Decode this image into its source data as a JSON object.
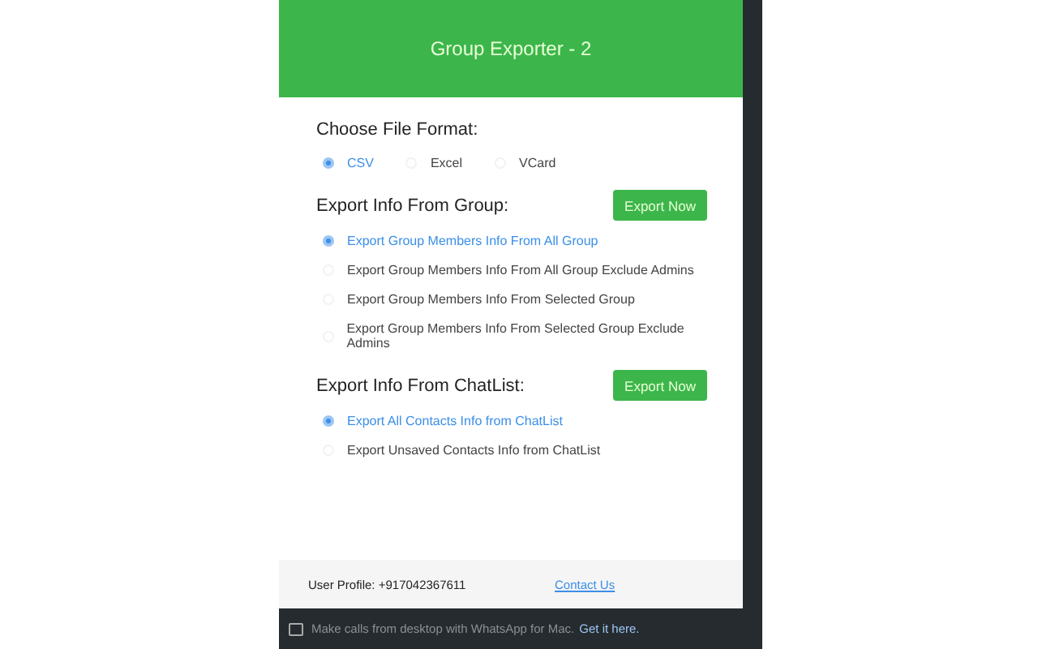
{
  "header": {
    "title": "Group Exporter - 2"
  },
  "file_format": {
    "heading": "Choose File Format:",
    "options": [
      {
        "label": "CSV",
        "selected": true
      },
      {
        "label": "Excel",
        "selected": false
      },
      {
        "label": "VCard",
        "selected": false
      }
    ]
  },
  "group_section": {
    "heading": "Export Info From Group:",
    "button": "Export Now",
    "options": [
      {
        "label": "Export Group Members Info From All Group",
        "selected": true
      },
      {
        "label": "Export Group Members Info From All Group Exclude Admins",
        "selected": false
      },
      {
        "label": "Export Group Members Info From Selected Group",
        "selected": false
      },
      {
        "label": "Export Group Members Info From Selected Group Exclude Admins",
        "selected": false
      }
    ]
  },
  "chatlist_section": {
    "heading": "Export Info From ChatList:",
    "button": "Export Now",
    "options": [
      {
        "label": "Export All Contacts Info from ChatList",
        "selected": true
      },
      {
        "label": "Export Unsaved Contacts Info from ChatList",
        "selected": false
      }
    ]
  },
  "footer": {
    "user_profile": "User Profile: +917042367611",
    "contact_link": "Contact Us"
  },
  "bottom_bar": {
    "text": "Make calls from desktop with WhatsApp for Mac.",
    "link": "Get it here."
  }
}
